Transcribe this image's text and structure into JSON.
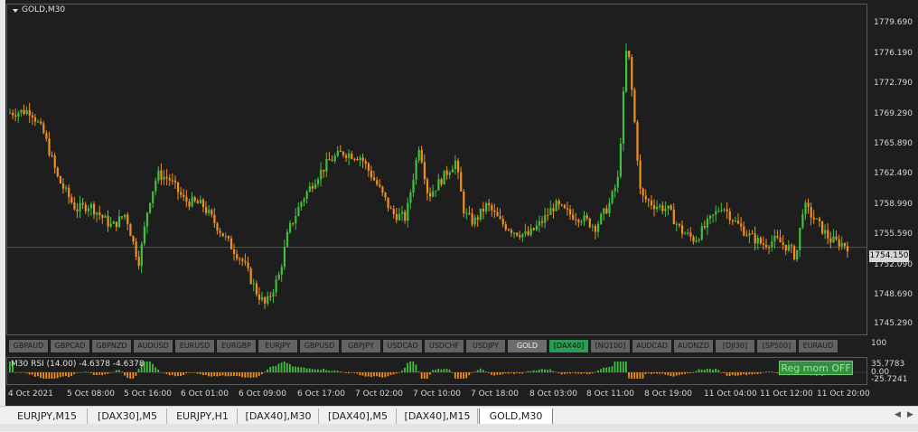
{
  "chart": {
    "title": "GOLD,M30",
    "current_price": "1754.150",
    "price_labels": [
      "1779.690",
      "1776.190",
      "1772.790",
      "1769.290",
      "1765.890",
      "1762.490",
      "1758.990",
      "1755.590",
      "1752.090",
      "1748.690",
      "1745.290"
    ],
    "price_min": 1744.2,
    "price_max": 1781.9,
    "up_color": "#3fc03f",
    "down_color": "#f0901e"
  },
  "symbols": [
    {
      "label": "GBPAUD",
      "state": "normal"
    },
    {
      "label": "GBPCAD",
      "state": "normal"
    },
    {
      "label": "GBPNZD",
      "state": "normal"
    },
    {
      "label": "AUDUSD",
      "state": "normal"
    },
    {
      "label": "EURUSD",
      "state": "normal"
    },
    {
      "label": "EURGBP",
      "state": "normal"
    },
    {
      "label": "EURJPY",
      "state": "normal"
    },
    {
      "label": "GBPUSD",
      "state": "normal"
    },
    {
      "label": "GBPJPY",
      "state": "normal"
    },
    {
      "label": "USDCAD",
      "state": "normal"
    },
    {
      "label": "USDCHF",
      "state": "normal"
    },
    {
      "label": "USDJPY",
      "state": "normal"
    },
    {
      "label": "GOLD",
      "state": "active"
    },
    {
      "label": "[DAX40]",
      "state": "green"
    },
    {
      "label": "[NQ100]",
      "state": "normal"
    },
    {
      "label": "AUDCAD",
      "state": "normal"
    },
    {
      "label": "AUDNZD",
      "state": "normal"
    },
    {
      "label": "[DJI30]",
      "state": "normal"
    },
    {
      "label": "[SP500]",
      "state": "normal"
    },
    {
      "label": "EURAUD",
      "state": "normal"
    }
  ],
  "rsi": {
    "title": "M30 RSI (14.00) -4.6378 -4.6378",
    "level_top": "100",
    "level_upper": "35.7783",
    "level_zero": "0.00",
    "level_lower": "-25.7241",
    "button_label": "Reg mom OFF"
  },
  "time_labels": [
    "4 Oct 2021",
    "5 Oct 08:00",
    "5 Oct 16:00",
    "6 Oct 01:00",
    "6 Oct 09:00",
    "6 Oct 17:00",
    "7 Oct 02:00",
    "7 Oct 10:00",
    "7 Oct 18:00",
    "8 Oct 03:00",
    "8 Oct 11:00",
    "8 Oct 19:00",
    "11 Oct 04:00",
    "11 Oct 12:00",
    "11 Oct 20:00"
  ],
  "tabs": [
    {
      "label": "EURJPY,M15",
      "active": false
    },
    {
      "label": "[DAX30],M5",
      "active": false
    },
    {
      "label": "EURJPY,H1",
      "active": false
    },
    {
      "label": "[DAX40],M30",
      "active": false
    },
    {
      "label": "[DAX40],M5",
      "active": false
    },
    {
      "label": "[DAX40],M15",
      "active": false
    },
    {
      "label": "GOLD,M30",
      "active": true
    }
  ],
  "icons": {
    "tab_scroll_left": "triangle-left-icon",
    "tab_scroll_right": "triangle-right-icon",
    "title_menu": "triangle-down-icon"
  }
}
